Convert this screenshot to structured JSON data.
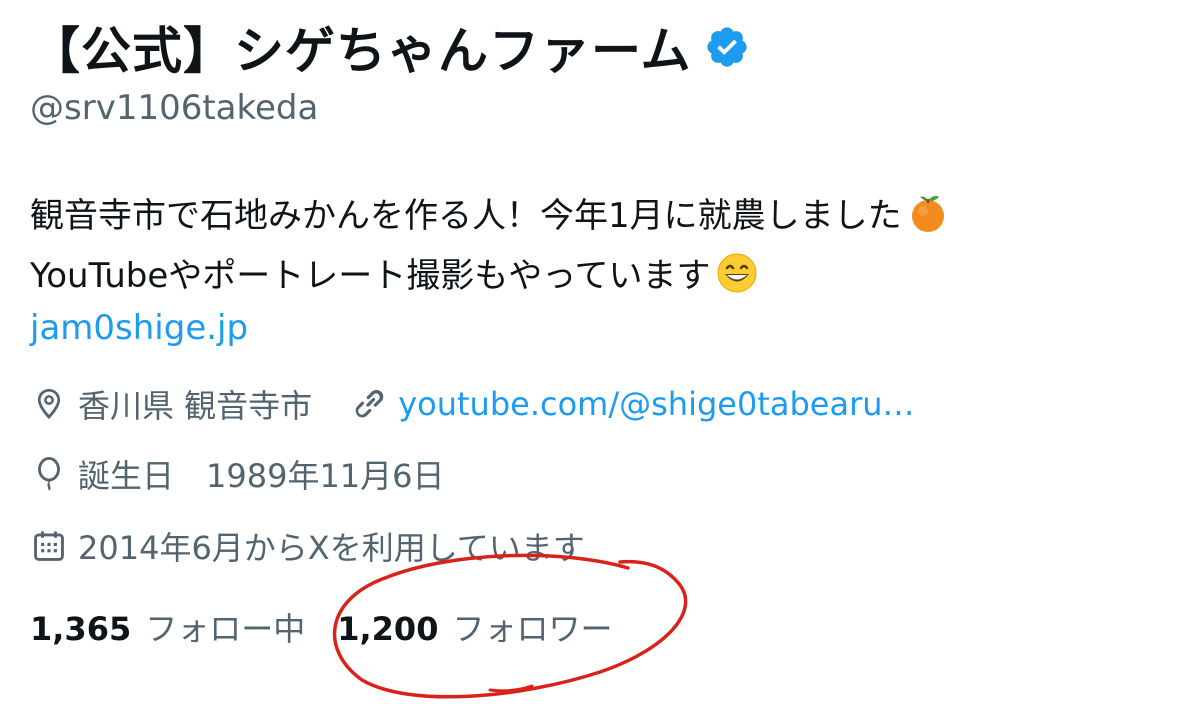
{
  "profile": {
    "display_name": "【公式】シゲちゃんファーム",
    "verified": true,
    "handle": "@srv1106takeda",
    "bio": {
      "line1": "観音寺市で石地みかんを作る人！今年1月に就農しました",
      "line1_emoji": "tangerine-emoji",
      "line2": "YouTubeやポートレート撮影もやっています",
      "line2_emoji": "grinning-face-emoji"
    },
    "website": "jam0shige.jp",
    "location": "香川県 観音寺市",
    "link": "youtube.com/@shige0tabearu…",
    "birthday": "誕生日　1989年11月6日",
    "joined": "2014年6月からXを利用しています",
    "following_count": "1,365",
    "following_label": "フォロー中",
    "followers_count": "1,200",
    "followers_label": "フォロワー"
  },
  "icons": {
    "verified": "verified-badge-icon",
    "location": "location-pin-icon",
    "link": "link-icon",
    "birthday": "balloon-icon",
    "joined": "calendar-icon"
  },
  "colors": {
    "text_primary": "#0f1419",
    "text_secondary": "#536471",
    "link": "#1d9bf0",
    "verified": "#1d9bf0",
    "annotation": "#d9231a"
  }
}
